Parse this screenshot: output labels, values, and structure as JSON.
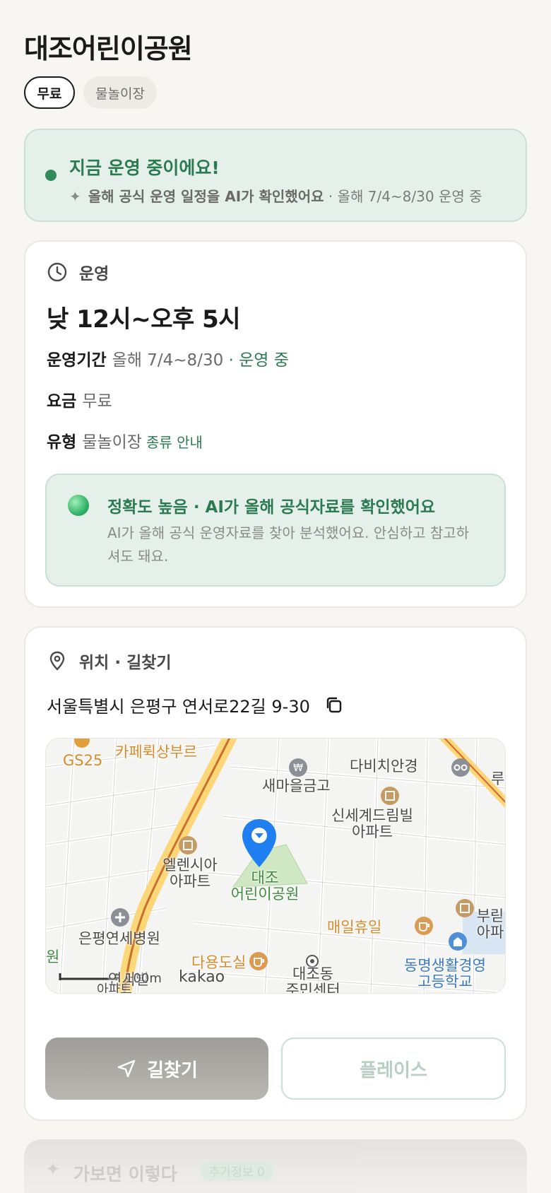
{
  "place": {
    "title": "대조어린이공원",
    "chips": [
      "무료",
      "물놀이장"
    ]
  },
  "status_banner": {
    "headline": "지금 운영 중이에요!",
    "sub_bold": "올해 공식 운영 일정을 AI가 확인했어요",
    "sub_rest": " · 올해 7/4~8/30 운영 중"
  },
  "operation": {
    "section_title": "운영",
    "hours": "낮 12시~오후 5시",
    "period_label": "운영기간",
    "period_value": "올해 7/4~8/30",
    "period_status": " · 운영 중",
    "fee_label": "요금",
    "fee_value": "무료",
    "type_label": "유형",
    "type_value": "물놀이장",
    "type_link": "종류 안내",
    "accuracy": {
      "headline": "정확도 높음 · AI가 올해 공식자료를 확인했어요",
      "body": "AI가 올해 공식 운영자료를 찾아 분석했어요. 안심하고 참고하셔도 돼요."
    }
  },
  "location": {
    "section_title": "위치 · 길찾기",
    "address": "서울특별시 은평구 연서로22길 9-30",
    "map_labels": {
      "gs25": "GS25",
      "cafe": "카페뤽상부르",
      "saemaeul": "새마을금고",
      "davinci": "다비치안경",
      "shinsegae_1": "신세계드림빌",
      "shinsegae_2": "아파트",
      "ellen_1": "엘렌시아",
      "ellen_2": "아파트",
      "park_1": "대조",
      "park_2": "어린이공원",
      "hospital": "은평연세병원",
      "cafe2": "매일휴일",
      "dayong": "다용도실",
      "community_1": "대조동",
      "community_2": "주민센터",
      "school_1": "동명생활경영",
      "school_2": "고등학교",
      "right_edge_1": "부릳",
      "right_edge_2": "아파",
      "right_top": "루",
      "left_edge": "원",
      "yeonseo": "연서빌",
      "scale": "100m",
      "provider": "kakao",
      "apt_bottom": "아파트"
    },
    "directions_label": "길찾기",
    "place_label": "플레이스"
  },
  "next_section": {
    "title": "가보면 이렇다",
    "tag": "추가정보 0"
  },
  "colors": {
    "accent_green": "#2b7a52",
    "banner_bg": "#e6f0ea",
    "pin_blue": "#1f7ff0",
    "road_yellow": "#fbd779"
  }
}
